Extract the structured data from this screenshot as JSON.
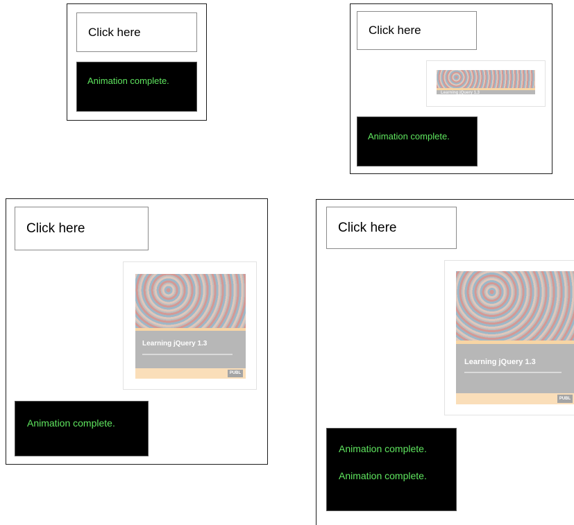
{
  "panels": [
    {
      "button_label": "Click here",
      "messages": [
        "Animation complete."
      ]
    },
    {
      "button_label": "Click here",
      "messages": [
        "Animation complete."
      ]
    },
    {
      "button_label": "Click here",
      "book_title": "Learning jQuery 1.3",
      "publisher_label": "PUBL",
      "messages": [
        "Animation complete."
      ]
    },
    {
      "button_label": "Click here",
      "book_title": "Learning jQuery 1.3",
      "publisher_label": "PUBL",
      "messages": [
        "Animation complete.",
        "Animation complete."
      ]
    }
  ],
  "colors": {
    "log_background": "#000000",
    "log_text": "#5fe65f",
    "book_cover_gray": "#7d7d7d",
    "book_footer": "#f6c480"
  }
}
